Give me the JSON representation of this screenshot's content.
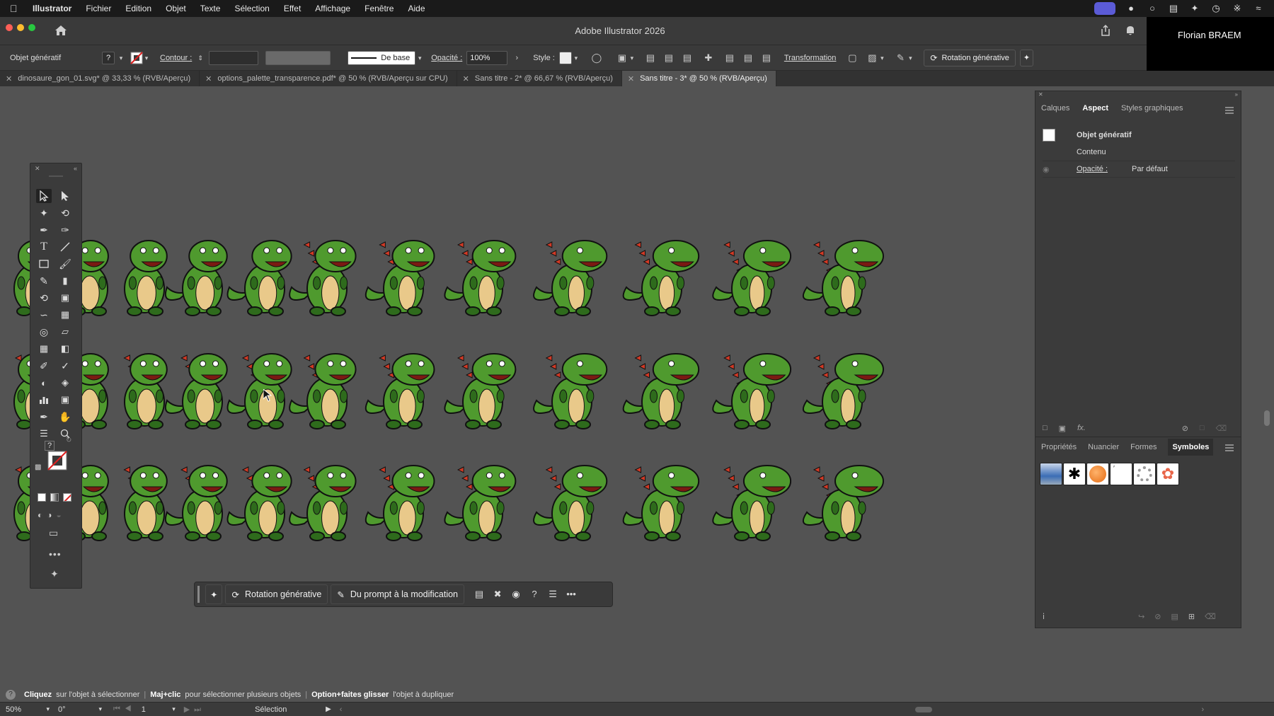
{
  "menubar": {
    "items": [
      "Illustrator",
      "Fichier",
      "Edition",
      "Objet",
      "Texte",
      "Sélection",
      "Effet",
      "Affichage",
      "Fenêtre",
      "Aide"
    ]
  },
  "window": {
    "title": "Adobe Illustrator 2026",
    "user": "Florian BRAEM"
  },
  "controlbar": {
    "object_type": "Objet génératif",
    "contour_label": "Contour :",
    "stroke_style": "De base",
    "opacity_label": "Opacité :",
    "opacity_value": "100%",
    "style_label": "Style :",
    "transformation_label": "Transformation",
    "rotation_button": "Rotation générative"
  },
  "tabs": [
    {
      "label": "dinosaure_gon_01.svg* @ 33,33 % (RVB/Aperçu)"
    },
    {
      "label": "options_palette_transparence.pdf* @ 50 % (RVB/Aperçu sur CPU)"
    },
    {
      "label": "Sans titre - 2* @ 66,67 % (RVB/Aperçu)"
    },
    {
      "label": "Sans titre - 3* @ 50 % (RVB/Aperçu)"
    }
  ],
  "aspect_panel": {
    "tabs": [
      "Calques",
      "Aspect",
      "Styles graphiques"
    ],
    "object": "Objet génératif",
    "content": "Contenu",
    "opacity_label": "Opacité :",
    "opacity_value": "Par défaut"
  },
  "symbols_panel": {
    "tabs": [
      "Propriétés",
      "Nuancier",
      "Formes",
      "Symboles"
    ]
  },
  "taskbar": {
    "rotation": "Rotation générative",
    "prompt": "Du prompt à la modification"
  },
  "hint": {
    "p1_bold": "Cliquez",
    "p1": "sur l'objet à sélectionner",
    "p2_bold": "Maj+clic",
    "p2": "pour sélectionner plusieurs objets",
    "p3_bold": "Option+faites glisser",
    "p3": "l'objet à dupliquer"
  },
  "statusbar": {
    "zoom": "50%",
    "rotation": "0°",
    "artboard": "1",
    "tool": "Sélection"
  },
  "colors": {
    "dino_green": "#4f9a2e",
    "dino_dark": "#2e6b1c",
    "dino_belly": "#e9c98a",
    "dino_spikes": "#d23a26",
    "accent": "#5b5bd6"
  }
}
